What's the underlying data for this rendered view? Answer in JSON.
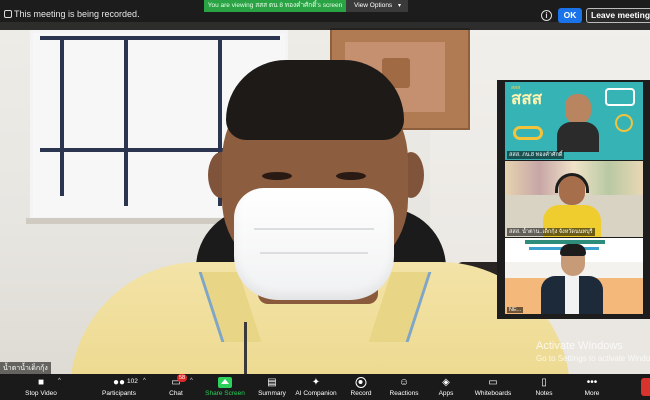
{
  "top_bar": {
    "recording_text": "This meeting is being recorded.",
    "viewing_banner": "You are viewing สสส ตน 8 ทองคำศักดิ์'s screen",
    "view_options_label": "View Options",
    "ok_label": "OK",
    "leave_label": "Leave meeting"
  },
  "participants_panel": {
    "tiles": [
      {
        "label": "สสส. ภน.8 ทองคำศักดิ์",
        "logo_text": "สสส",
        "logo_top": "สสส"
      },
      {
        "label": "สสส. น้ำตาน..เด็กกุ้ง จังหวัดนนทบุรี"
      },
      {
        "label": "NE..."
      }
    ]
  },
  "main_video": {
    "name_label": "น้ำตาน้ำเด็กกุ้ง"
  },
  "watermark": {
    "title": "Activate Windows",
    "subtitle": "Go to Settings to activate Windows."
  },
  "toolbar": {
    "stop_video": "Stop Video",
    "participants": "Participants",
    "participants_count": "102",
    "chat": "Chat",
    "chat_badge": "58",
    "share_screen": "Share Screen",
    "summary": "Summary",
    "ai_companion": "AI Companion",
    "record": "Record",
    "reactions": "Reactions",
    "apps": "Apps",
    "whiteboards": "Whiteboards",
    "notes": "Notes",
    "more": "More"
  },
  "colors": {
    "share_green": "#2bd15a",
    "ok_blue": "#1a73e8",
    "banner_green": "#29a344",
    "end_red": "#d9332d"
  }
}
